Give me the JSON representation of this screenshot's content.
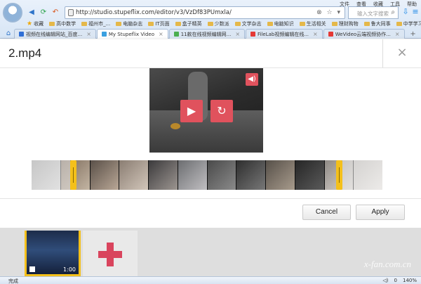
{
  "browser": {
    "url": "http://studio.stupeflix.com/editor/v3/VzDf83PUmxla/",
    "search_placeholder": "输入文字搜索",
    "top_menu": [
      "文件",
      "查看",
      "收藏",
      "工具",
      "帮助"
    ],
    "favorites_label": "收藏",
    "favorites": [
      "高中数学",
      "福州市_...",
      "电脑杂志",
      "IT页面",
      "盒子精英",
      "少数派",
      "文学杂志",
      "电脑知识",
      "生活相关",
      "理财购物",
      "鲁大同事",
      "中学学习"
    ],
    "tabs": [
      {
        "label": "视频在线编辑网站_百度...",
        "active": false,
        "color": "#2f6fd6"
      },
      {
        "label": "My Stupeflix Video",
        "active": true,
        "color": "#3aa0e0"
      },
      {
        "label": "11款在线视频编辑网...",
        "active": false,
        "color": "#4caf50"
      },
      {
        "label": "FileLab视频编辑在线...",
        "active": false,
        "color": "#e53935"
      },
      {
        "label": "WeVideo云端视频协作...",
        "active": false,
        "color": "#e53935"
      }
    ]
  },
  "modal": {
    "title": "2.mp4",
    "cancel_label": "Cancel",
    "apply_label": "Apply",
    "close_label": "×"
  },
  "timeline": {
    "clip_duration": "1:00"
  },
  "watermark": "x-fan.com.cn",
  "statusbar": {
    "text": "完成",
    "zoom": "140%",
    "count": "0"
  },
  "icons": {
    "play": "play-icon",
    "replay": "replay-icon",
    "volume": "volume-icon",
    "plus": "plus-icon"
  },
  "colors": {
    "accent": "#e0525d",
    "trim": "#f4c01b",
    "plus": "#d9445d"
  }
}
